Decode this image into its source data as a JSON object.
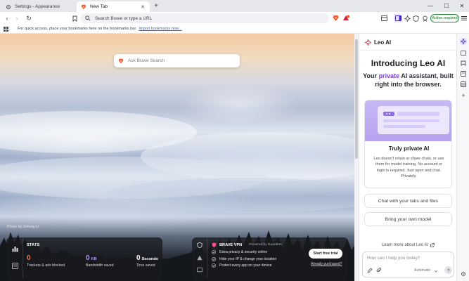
{
  "tabs": [
    {
      "label": "Settings - Appearance",
      "active": false
    },
    {
      "label": "New Tab",
      "active": true
    }
  ],
  "toolbar": {
    "omnibox_placeholder": "Search Brave or type a URL",
    "action_required": "Action required"
  },
  "bookmarks_bar": {
    "message": "For quick access, place your bookmarks here on the bookmarks bar.",
    "import_link": "Import bookmarks now..."
  },
  "ntp": {
    "search_placeholder": "Ask Brave Search",
    "photo_credit": "Photo by Zefeng Li"
  },
  "stats": {
    "title": "STATS",
    "items": [
      {
        "value": "0",
        "unit": "",
        "label": "Trackers & ads blocked",
        "color": "#ff7a45"
      },
      {
        "value": "0",
        "unit": "KB",
        "label": "Bandwidth saved",
        "color": "#b39bff"
      },
      {
        "value": "0",
        "unit": "Seconds",
        "label": "Time saved",
        "color": "#ffffff"
      }
    ]
  },
  "vpn": {
    "title": "BRAVE VPN",
    "powered_by": "Powered by  Guardian",
    "features": [
      "Extra privacy & security online",
      "Hide your IP & change your location",
      "Protect every app on your device"
    ],
    "trial_button": "Start free trial",
    "purchased_link": "Already purchased?"
  },
  "leo": {
    "header": "Leo AI",
    "title": "Introducing Leo AI",
    "subtitle_pre": "Your ",
    "subtitle_highlight": "private",
    "subtitle_post": " AI assistant, built right into the browser.",
    "card_title": "Truly private AI",
    "card_body": "Leo doesn't retain or share chats, or use them for model training. No account or login is required. Just open and chat. Privately.",
    "suggestion_1": "Chat with your tabs and files",
    "suggestion_2": "Bring your own model",
    "learn_more": "Learn more about Leo AI",
    "input_placeholder": "How can I help you today?",
    "model_select": "Automatic"
  },
  "colors": {
    "accent": "#7b40d9",
    "brave_orange": "#fb542b",
    "action_green": "#2d8a3e"
  }
}
